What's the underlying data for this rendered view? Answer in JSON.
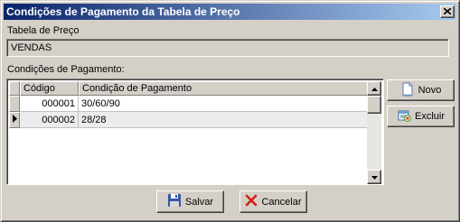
{
  "window": {
    "title": "Condições de Pagamento da Tabela de Preço",
    "close_glyph": "✕"
  },
  "price_table": {
    "label": "Tabela de Preço",
    "value": "VENDAS"
  },
  "payment_conditions": {
    "label": "Condições de Pagamento:",
    "columns": [
      "Código",
      "Condição de Pagamento"
    ],
    "rows": [
      {
        "code": "000001",
        "condition": "30/60/90"
      },
      {
        "code": "000002",
        "condition": "28/28"
      }
    ],
    "selected_row": 2
  },
  "buttons": {
    "new_label": "Novo",
    "delete_label": "Excluir",
    "save_label": "Salvar",
    "cancel_label": "Cancelar"
  },
  "icons": {
    "new": "new-document-icon",
    "delete": "delete-records-icon",
    "save": "floppy-disk-icon",
    "cancel": "red-x-icon",
    "row_indicator": "triangle-right-icon"
  }
}
